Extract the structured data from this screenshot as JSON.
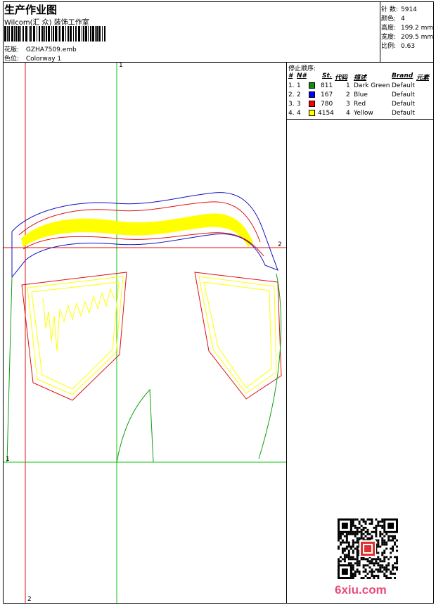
{
  "header": {
    "title": "生产作业图",
    "subtitle": "Wilcom(汇 众) 装饰工作室",
    "design_label": "花版:",
    "design_value": "GZHA7509.emb",
    "colorway_label": "色位:",
    "colorway_value": "Colorway 1"
  },
  "specs": [
    {
      "label": "针 数:",
      "value": "5914"
    },
    {
      "label": "颜色:",
      "value": "4"
    },
    {
      "label": "高度:",
      "value": "199.2 mm"
    },
    {
      "label": "宽度:",
      "value": "209.5 mm"
    },
    {
      "label": "比例:",
      "value": "0.63"
    }
  ],
  "stop_sequence": {
    "title": "停止顺序:",
    "headers": {
      "num": "#",
      "needle": "N#",
      "stitches": "St.",
      "code": "代码",
      "desc": "描述",
      "brand": "Brand",
      "elements": "元素"
    },
    "rows": [
      {
        "num": "1.",
        "needle": "1",
        "color": "#109010",
        "stitches": "811",
        "code": "1",
        "desc": "Dark Green",
        "brand": "Default"
      },
      {
        "num": "2.",
        "needle": "2",
        "color": "#0000ff",
        "stitches": "167",
        "code": "2",
        "desc": "Blue",
        "brand": "Default"
      },
      {
        "num": "3.",
        "needle": "3",
        "color": "#ff0000",
        "stitches": "780",
        "code": "3",
        "desc": "Red",
        "brand": "Default"
      },
      {
        "num": "4.",
        "needle": "4",
        "color": "#ffff00",
        "stitches": "4154",
        "code": "4",
        "desc": "Yellow",
        "brand": "Default"
      }
    ]
  },
  "axes": {
    "v1": "1",
    "h2": "2",
    "v2": "2",
    "origin": "1"
  },
  "watermark": "6xiu.com",
  "colors": {
    "red": "#e01010",
    "green": "#10b010",
    "blue": "#1010c0",
    "yellow": "#ffff00"
  }
}
